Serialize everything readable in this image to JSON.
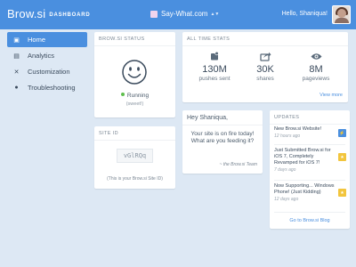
{
  "header": {
    "logo": "Brow.si",
    "section": "DASHBOARD",
    "site_name": "Say-What.com",
    "greeting": "Hello, Shaniqua!"
  },
  "sidebar": {
    "items": [
      {
        "label": "Home",
        "icon": "home-icon",
        "active": true
      },
      {
        "label": "Analytics",
        "icon": "chart-icon",
        "active": false
      },
      {
        "label": "Customization",
        "icon": "tools-icon",
        "active": false
      },
      {
        "label": "Troubleshooting",
        "icon": "chat-bubble-icon",
        "active": false
      }
    ]
  },
  "status": {
    "title": "BROW.SI STATUS",
    "state": "Running",
    "note": "(sweet!)",
    "status_color": "#5fbf4d"
  },
  "stats": {
    "title": "ALL TIME STATS",
    "items": [
      {
        "value": "130M",
        "label": "pushes sent",
        "icon": "push-icon"
      },
      {
        "value": "30K",
        "label": "shares",
        "icon": "share-icon"
      },
      {
        "value": "8M",
        "label": "pageviews",
        "icon": "eye-icon"
      }
    ],
    "view_more": "View more"
  },
  "site_id": {
    "title": "SITE ID",
    "value": "vGlRQq",
    "caption": "(This is your Brow.si Site ID)"
  },
  "message": {
    "greeting": "Hey Shaniqua,",
    "body": "Your site is on fire today! What are you feeding it?",
    "signature": "~ the Brow.si Team"
  },
  "updates": {
    "title": "UPDATES",
    "items": [
      {
        "title": "New Brow.si Website!",
        "time": "12 hours ago",
        "badge_color": "#4a8fdf",
        "badge_icon": "lightning-icon"
      },
      {
        "title": "Just Submitted Brow.si for iOS 7, Completely Revamped for iOS 7!",
        "time": "7 days ago",
        "badge_color": "#f2c53d",
        "badge_icon": "star-icon"
      },
      {
        "title": "Now Supporting... Windows Phone! (Just Kidding)",
        "time": "12 days ago",
        "badge_color": "#f2c53d",
        "badge_icon": "star-icon"
      }
    ],
    "blog_link": "Go to Brow.si Blog"
  },
  "colors": {
    "accent": "#4a8fdf",
    "background": "#dde8f4"
  }
}
